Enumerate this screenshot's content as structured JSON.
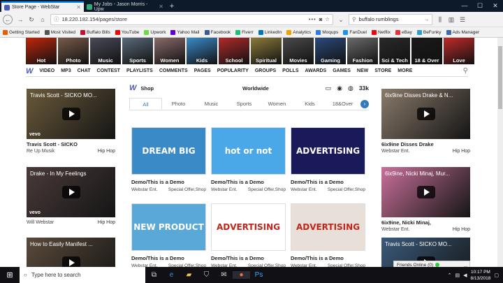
{
  "browser": {
    "tabs": [
      {
        "title": "Store Page - WebStar",
        "active": true
      },
      {
        "title": "My Jobs - Jason Morris - Upw",
        "active": false
      }
    ],
    "url": "18.220.182.154/pages/store",
    "search_value": "buffalo rumblings",
    "bookmarks": [
      {
        "label": "Getting Started",
        "color": "#e66000"
      },
      {
        "label": "Most Visited",
        "color": "#555555"
      },
      {
        "label": "Buffalo Bills",
        "color": "#c8102e"
      },
      {
        "label": "YouTube",
        "color": "#ff0000"
      },
      {
        "label": "Upwork",
        "color": "#6fda44"
      },
      {
        "label": "Yahoo Mail",
        "color": "#6001d2"
      },
      {
        "label": "Facebook",
        "color": "#3b5998"
      },
      {
        "label": "Fiverr",
        "color": "#1dbf73"
      },
      {
        "label": "LinkedIn",
        "color": "#0077b5"
      },
      {
        "label": "Analytics",
        "color": "#f4a100"
      },
      {
        "label": "Moqups",
        "color": "#2c7be5"
      },
      {
        "label": "FanDuel",
        "color": "#1493ff"
      },
      {
        "label": "Netflix",
        "color": "#e50914"
      },
      {
        "label": "eBay",
        "color": "#e53238"
      },
      {
        "label": "BeFunky",
        "color": "#2d9cdb"
      },
      {
        "label": "Ads Manager",
        "color": "#4267b2"
      }
    ]
  },
  "categories": [
    {
      "label": "Hot",
      "color": "#c0260c"
    },
    {
      "label": "Photo",
      "color": "#7a5a4a"
    },
    {
      "label": "Music",
      "color": "#4a4a5a"
    },
    {
      "label": "Sports",
      "color": "#5a6a7a"
    },
    {
      "label": "Women",
      "color": "#8a6a6a"
    },
    {
      "label": "Kids",
      "color": "#3a8ac8"
    },
    {
      "label": "School",
      "color": "#b02a2a"
    },
    {
      "label": "Spiritual",
      "color": "#8a7a3a"
    },
    {
      "label": "Movies",
      "color": "#4a4a4a"
    },
    {
      "label": "Gaming",
      "color": "#2a4a7a"
    },
    {
      "label": "Fashion",
      "color": "#6a6a6a"
    },
    {
      "label": "Sci & Tech",
      "color": "#2a2a2a"
    },
    {
      "label": "18 & Over",
      "color": "#1a1a1a"
    },
    {
      "label": "Love",
      "color": "#c02a2a"
    }
  ],
  "sitenav": [
    "VIDEO",
    "MP3",
    "CHAT",
    "CONTEST",
    "PLAYLISTS",
    "COMMENTS",
    "PAGES",
    "POPULARITY",
    "GROUPS",
    "POLLS",
    "AWARDS",
    "GAMES",
    "NEW",
    "STORE",
    "MORE"
  ],
  "left_videos": [
    {
      "overlay": "Travis Scott - SICKO MO...",
      "name": "Travis Scott - SICKO",
      "channel": "Re Up Musik",
      "genre": "Hip Hop",
      "bg": "#6a5a3a",
      "vevo": "vevo"
    },
    {
      "overlay": "Drake - In My Feelings",
      "name": "",
      "channel": "Will Webstar",
      "genre": "Hip Hop",
      "bg": "#4a3a3a",
      "vevo": "vevo"
    },
    {
      "overlay": "How to Easily Manifest ...",
      "name": "",
      "channel": "",
      "genre": "",
      "bg": "#5a4a3a",
      "vevo": ""
    }
  ],
  "right_videos": [
    {
      "overlay": "6ix9ine Disses Drake & N...",
      "name": "6ix9ine Disses Drake",
      "channel": "Webstar Ent.",
      "genre": "Hip Hop",
      "bg": "#8a7a6a",
      "vevo": ""
    },
    {
      "overlay": "6ix9ine, Nicki Minaj, Mur...",
      "name": "6ix9ine, Nicki Minaj,",
      "channel": "Webstar Ent.",
      "genre": "Hip Hop",
      "bg": "#c8709a",
      "vevo": ""
    },
    {
      "overlay": "Travis Scott - SICKO MO...",
      "name": "",
      "channel": "",
      "genre": "",
      "bg": "#3a5a7a",
      "vevo": ""
    }
  ],
  "shop": {
    "title": "Shop",
    "region": "Worldwide",
    "count": "33k",
    "tabs": [
      "All",
      "Photo",
      "Music",
      "Sports",
      "Women",
      "Kids",
      "18&Over"
    ],
    "products": [
      {
        "title": "Demo/This is a Demo",
        "seller": "Webstar Ent.",
        "tag": "Special Offer,Shop",
        "art": "DREAM BIG",
        "bg": "#3a8ac8"
      },
      {
        "title": "Demo/This is a Demo",
        "seller": "Webstar Ent.",
        "tag": "Special Offer,Shop",
        "art": "hot or not",
        "bg": "#4aa8e8"
      },
      {
        "title": "Demo/This is a Demo",
        "seller": "Webstar Ent.",
        "tag": "Special Offer,Shop",
        "art": "ADVERTISING",
        "bg": "#1a1a5a"
      },
      {
        "title": "Demo/This is a Demo",
        "seller": "Webstar Ent.",
        "tag": "Special Offer,Shop",
        "art": "NEW PRODUCT",
        "bg": "#5aa8d8"
      },
      {
        "title": "Demo/This is a Demo",
        "seller": "Webstar Ent.",
        "tag": "Special Offer,Shop",
        "art": "ADVERTISING",
        "bg": "#ffffff"
      },
      {
        "title": "Demo/This is a Demo",
        "seller": "Webstar Ent.",
        "tag": "Special Offer,Shop",
        "art": "ADVERTISING",
        "bg": "#e8e0d8"
      }
    ]
  },
  "friends": {
    "label": "Friends Online (0)"
  },
  "taskbar": {
    "search_placeholder": "Type here to search",
    "time": "10:17 PM",
    "date": "8/13/2018"
  }
}
